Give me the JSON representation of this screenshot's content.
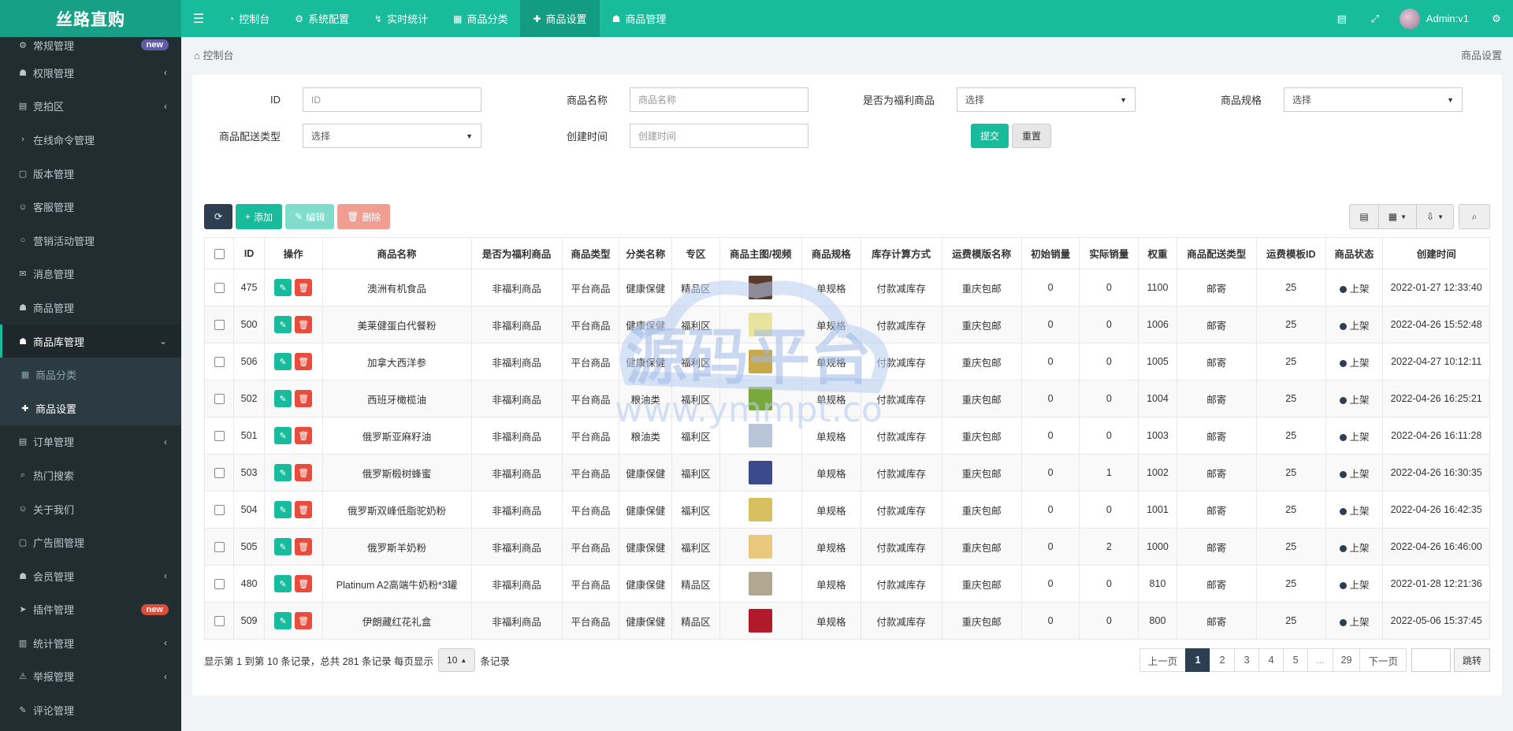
{
  "brand": "丝路直购",
  "topnav": {
    "tabs": [
      {
        "label": "控制台",
        "icon": "dashboard-icon",
        "active": false
      },
      {
        "label": "系统配置",
        "icon": "gear-icon",
        "active": false
      },
      {
        "label": "实时统计",
        "icon": "chart-icon",
        "active": false
      },
      {
        "label": "商品分类",
        "icon": "grid-icon",
        "active": false
      },
      {
        "label": "商品设置",
        "icon": "gift-icon",
        "active": true
      },
      {
        "label": "商品管理",
        "icon": "user-icon",
        "active": false
      }
    ],
    "user": "Admin:v1"
  },
  "sidebar": {
    "items": [
      {
        "label": "常规管理",
        "badge": "new",
        "badge_color": "#605ca8"
      },
      {
        "label": "权限管理",
        "arrow": true
      },
      {
        "label": "竞拍区",
        "arrow": true
      },
      {
        "label": "在线命令管理"
      },
      {
        "label": "版本管理"
      },
      {
        "label": "客服管理"
      },
      {
        "label": "营销活动管理"
      },
      {
        "label": "消息管理"
      },
      {
        "label": "商品管理"
      },
      {
        "label": "商品库管理",
        "open": true
      },
      {
        "label": "商品分类",
        "sub": true
      },
      {
        "label": "商品设置",
        "sub": true,
        "current": true
      },
      {
        "label": "订单管理",
        "arrow": true
      },
      {
        "label": "热门搜索"
      },
      {
        "label": "关于我们"
      },
      {
        "label": "广告图管理"
      },
      {
        "label": "会员管理",
        "arrow": true
      },
      {
        "label": "插件管理",
        "badge": "new",
        "badge_color": "#dd4b39"
      },
      {
        "label": "统计管理",
        "arrow": true
      },
      {
        "label": "举报管理",
        "arrow": true
      },
      {
        "label": "评论管理"
      }
    ]
  },
  "breadcrumb": {
    "home": "控制台",
    "current": "商品设置"
  },
  "filters": {
    "id_label": "ID",
    "id_placeholder": "ID",
    "name_label": "商品名称",
    "name_placeholder": "商品名称",
    "welfare_label": "是否为福利商品",
    "welfare_value": "选择",
    "spec_label": "商品规格",
    "spec_value": "选择",
    "delivery_label": "商品配送类型",
    "delivery_value": "选择",
    "created_label": "创建时间",
    "created_placeholder": "创建时间",
    "submit": "提交",
    "reset": "重置"
  },
  "toolbar": {
    "add": "添加",
    "edit": "编辑",
    "delete": "删除"
  },
  "table": {
    "headers": [
      "ID",
      "操作",
      "商品名称",
      "是否为福利商品",
      "商品类型",
      "分类名称",
      "专区",
      "商品主图/视频",
      "商品规格",
      "库存计算方式",
      "运费模版名称",
      "初始销量",
      "实际销量",
      "权重",
      "商品配送类型",
      "运费模板ID",
      "商品状态",
      "创建时间"
    ],
    "rows": [
      {
        "id": "475",
        "name": "澳洲有机食品",
        "welfare": "非福利商品",
        "type": "平台商品",
        "category": "健康保健",
        "zone": "精品区",
        "thumb": "#5a3a2a",
        "spec": "单规格",
        "stock": "付款减库存",
        "freight": "重庆包邮",
        "init_sales": "0",
        "real_sales": "0",
        "weight": "1100",
        "delivery": "邮寄",
        "freight_id": "25",
        "status": "上架",
        "created": "2022-01-27 12:33:40"
      },
      {
        "id": "500",
        "name": "美莱健蛋白代餐粉",
        "welfare": "非福利商品",
        "type": "平台商品",
        "category": "健康保健",
        "zone": "福利区",
        "thumb": "#e8e4a0",
        "spec": "单规格",
        "stock": "付款减库存",
        "freight": "重庆包邮",
        "init_sales": "0",
        "real_sales": "0",
        "weight": "1006",
        "delivery": "邮寄",
        "freight_id": "25",
        "status": "上架",
        "created": "2022-04-26 15:52:48"
      },
      {
        "id": "506",
        "name": "加拿大西洋参",
        "welfare": "非福利商品",
        "type": "平台商品",
        "category": "健康保健",
        "zone": "福利区",
        "thumb": "#c9a84a",
        "spec": "单规格",
        "stock": "付款减库存",
        "freight": "重庆包邮",
        "init_sales": "0",
        "real_sales": "0",
        "weight": "1005",
        "delivery": "邮寄",
        "freight_id": "25",
        "status": "上架",
        "created": "2022-04-27 10:12:11"
      },
      {
        "id": "502",
        "name": "西班牙橄榄油",
        "welfare": "非福利商品",
        "type": "平台商品",
        "category": "粮油类",
        "zone": "福利区",
        "thumb": "#7aa83a",
        "spec": "单规格",
        "stock": "付款减库存",
        "freight": "重庆包邮",
        "init_sales": "0",
        "real_sales": "0",
        "weight": "1004",
        "delivery": "邮寄",
        "freight_id": "25",
        "status": "上架",
        "created": "2022-04-26 16:25:21"
      },
      {
        "id": "501",
        "name": "俄罗斯亚麻籽油",
        "welfare": "非福利商品",
        "type": "平台商品",
        "category": "粮油类",
        "zone": "福利区",
        "thumb": "#b8c4d8",
        "spec": "单规格",
        "stock": "付款减库存",
        "freight": "重庆包邮",
        "init_sales": "0",
        "real_sales": "0",
        "weight": "1003",
        "delivery": "邮寄",
        "freight_id": "25",
        "status": "上架",
        "created": "2022-04-26 16:11:28"
      },
      {
        "id": "503",
        "name": "俄罗斯椴树蜂蜜",
        "welfare": "非福利商品",
        "type": "平台商品",
        "category": "健康保健",
        "zone": "福利区",
        "thumb": "#3a4a8a",
        "spec": "单规格",
        "stock": "付款减库存",
        "freight": "重庆包邮",
        "init_sales": "0",
        "real_sales": "1",
        "weight": "1002",
        "delivery": "邮寄",
        "freight_id": "25",
        "status": "上架",
        "created": "2022-04-26 16:30:35"
      },
      {
        "id": "504",
        "name": "俄罗斯双峰低脂驼奶粉",
        "welfare": "非福利商品",
        "type": "平台商品",
        "category": "健康保健",
        "zone": "福利区",
        "thumb": "#d8c060",
        "spec": "单规格",
        "stock": "付款减库存",
        "freight": "重庆包邮",
        "init_sales": "0",
        "real_sales": "0",
        "weight": "1001",
        "delivery": "邮寄",
        "freight_id": "25",
        "status": "上架",
        "created": "2022-04-26 16:42:35"
      },
      {
        "id": "505",
        "name": "俄罗斯羊奶粉",
        "welfare": "非福利商品",
        "type": "平台商品",
        "category": "健康保健",
        "zone": "福利区",
        "thumb": "#e8c87a",
        "spec": "单规格",
        "stock": "付款减库存",
        "freight": "重庆包邮",
        "init_sales": "0",
        "real_sales": "2",
        "weight": "1000",
        "delivery": "邮寄",
        "freight_id": "25",
        "status": "上架",
        "created": "2022-04-26 16:46:00"
      },
      {
        "id": "480",
        "name": "Platinum A2高端牛奶粉*3罐",
        "welfare": "非福利商品",
        "type": "平台商品",
        "category": "健康保健",
        "zone": "精品区",
        "thumb": "#b0a890",
        "spec": "单规格",
        "stock": "付款减库存",
        "freight": "重庆包邮",
        "init_sales": "0",
        "real_sales": "0",
        "weight": "810",
        "delivery": "邮寄",
        "freight_id": "25",
        "status": "上架",
        "created": "2022-01-28 12:21:36"
      },
      {
        "id": "509",
        "name": "伊朗藏红花礼盒",
        "welfare": "非福利商品",
        "type": "平台商品",
        "category": "健康保健",
        "zone": "精品区",
        "thumb": "#b01a2a",
        "spec": "单规格",
        "stock": "付款减库存",
        "freight": "重庆包邮",
        "init_sales": "0",
        "real_sales": "0",
        "weight": "800",
        "delivery": "邮寄",
        "freight_id": "25",
        "status": "上架",
        "created": "2022-05-06 15:37:45"
      }
    ]
  },
  "pagination": {
    "info_prefix": "显示第 1 到第 10 条记录，总共 281 条记录 每页显示",
    "page_size": "10",
    "info_suffix": "条记录",
    "prev": "上一页",
    "pages": [
      "1",
      "2",
      "3",
      "4",
      "5",
      "...",
      "29"
    ],
    "next": "下一页",
    "go": "跳转"
  },
  "watermark": {
    "line1": "源码平台",
    "line2": "www.ymmpt.co"
  }
}
